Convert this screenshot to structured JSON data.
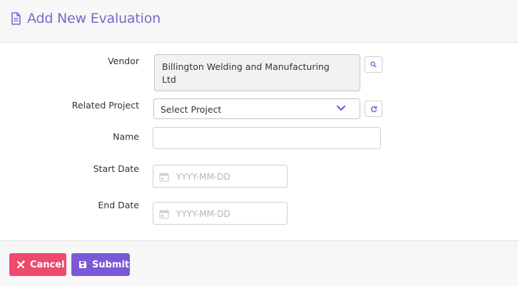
{
  "header": {
    "title": "Add New Evaluation",
    "icon": "document-icon"
  },
  "form": {
    "vendor": {
      "label": "Vendor",
      "value_line1": "Billington Welding and Manufacturing",
      "value_line2": "Ltd",
      "action_icon": "search-icon"
    },
    "related_project": {
      "label": "Related Project",
      "selected": "Select Project",
      "action_icon": "refresh-icon"
    },
    "name": {
      "label": "Name",
      "value": ""
    },
    "start_date": {
      "label": "Start Date",
      "placeholder": "YYYY-MM-DD",
      "icon": "calendar-icon"
    },
    "end_date": {
      "label": "End Date",
      "placeholder": "YYYY-MM-DD",
      "icon": "calendar-icon"
    }
  },
  "footer": {
    "cancel_label": "Cancel",
    "submit_label": "Submit"
  },
  "colors": {
    "accent": "#7b68c8",
    "cancel": "#ee4a6e",
    "submit": "#7b58d8"
  }
}
